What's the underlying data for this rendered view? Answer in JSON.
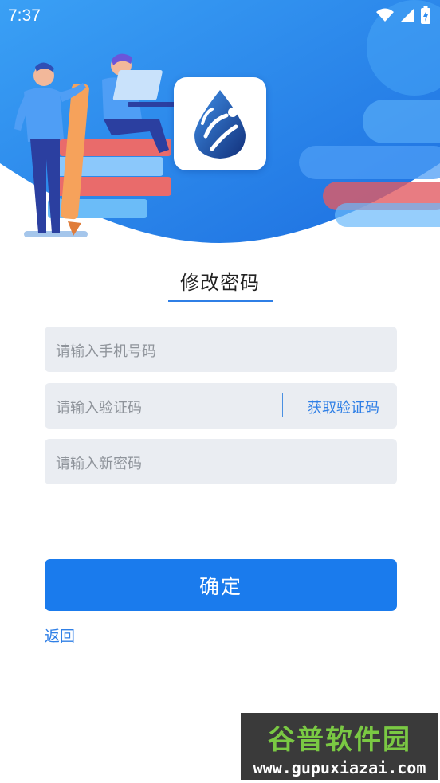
{
  "status_bar": {
    "time": "7:37",
    "icons": [
      "wifi-icon",
      "signal-icon",
      "battery-icon"
    ]
  },
  "page": {
    "title": "修改密码"
  },
  "form": {
    "phone": {
      "placeholder": "请输入手机号码",
      "value": ""
    },
    "code": {
      "placeholder": "请输入验证码",
      "value": "",
      "get_code_label": "获取验证码"
    },
    "new_password": {
      "placeholder": "请输入新密码",
      "value": ""
    }
  },
  "actions": {
    "confirm_label": "确定",
    "back_label": "返回"
  },
  "watermark": {
    "title": "谷普软件园",
    "url": "www.gupuxiazai.com"
  },
  "colors": {
    "primary": "#1a7bed",
    "accent": "#2f7fe6",
    "field_bg": "#eaedf2",
    "header_blue": "#2d8cf0"
  }
}
